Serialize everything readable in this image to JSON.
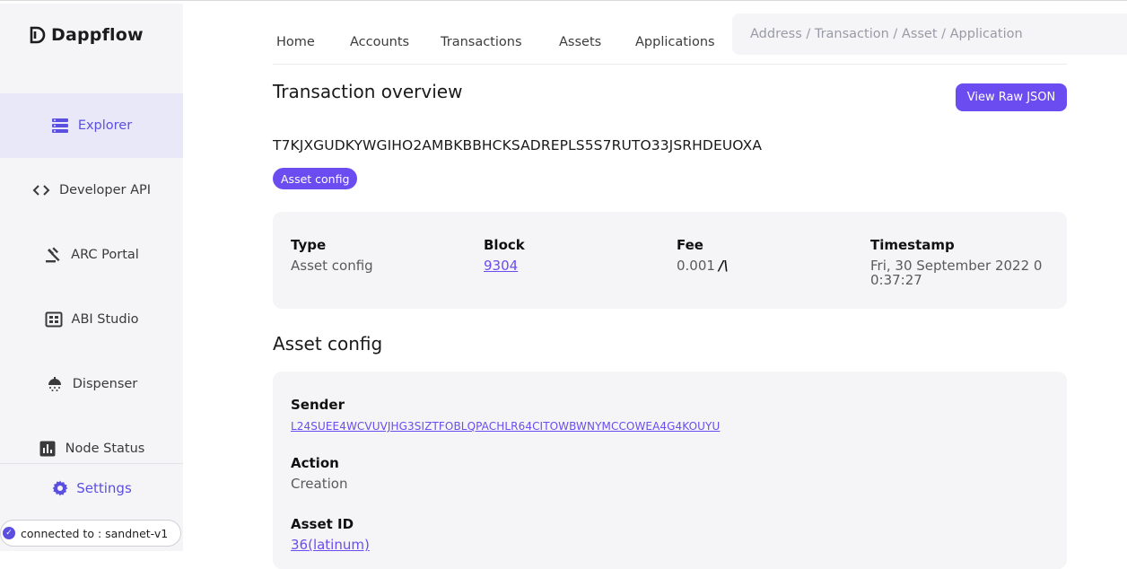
{
  "app": {
    "name": "Dappflow"
  },
  "sidebar": {
    "items": [
      {
        "label": "Explorer",
        "icon": "explorer-icon",
        "active": true
      },
      {
        "label": "Developer API",
        "icon": "code-icon"
      },
      {
        "label": "ARC Portal",
        "icon": "gavel-icon"
      },
      {
        "label": "ABI Studio",
        "icon": "abi-icon"
      },
      {
        "label": "Dispenser",
        "icon": "shower-icon"
      },
      {
        "label": "Node Status",
        "icon": "bar-chart-icon"
      }
    ],
    "settings_label": "Settings",
    "connection": "connected to : sandnet-v1"
  },
  "topnav": {
    "tabs": [
      "Home",
      "Accounts",
      "Transactions",
      "Assets",
      "Applications"
    ],
    "search_placeholder": "Address / Transaction / Asset / Application"
  },
  "overview": {
    "title": "Transaction overview",
    "raw_json_button": "View Raw JSON",
    "txid": "T7KJXGUDKYWGIHO2AMBKBBHCKSADREPLS5S7RUTO33JSRHDEUOXA",
    "type_badge": "Asset config",
    "type_label": "Type",
    "type_value": "Asset config",
    "block_label": "Block",
    "block_value": "9304",
    "fee_label": "Fee",
    "fee_value": "0.001",
    "timestamp_label": "Timestamp",
    "timestamp_value": "Fri, 30 September 2022 00:37:27"
  },
  "asset_config": {
    "title": "Asset config",
    "sender_label": "Sender",
    "sender_value": "L24SUEE4WCVUVJHG3SIZTFOBLQPACHLR64CITOWBWNYMCCOWEA4G4KOUYU",
    "action_label": "Action",
    "action_value": "Creation",
    "asset_id_label": "Asset ID",
    "asset_id_value": "36(latinum)"
  },
  "colors": {
    "accent": "#6a4cf0",
    "sidebar_bg": "#f5f5f8",
    "active_bg": "#e9e8f8"
  }
}
